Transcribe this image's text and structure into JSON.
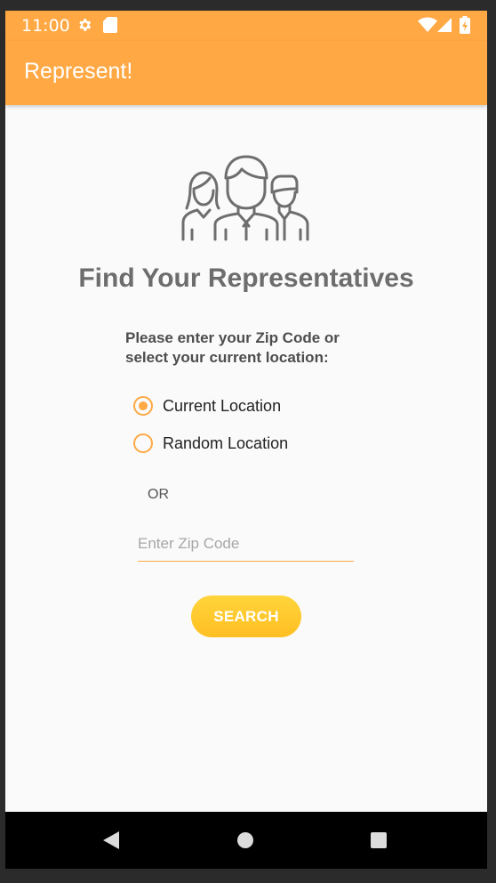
{
  "status_bar": {
    "time": "11:00",
    "icons": [
      "settings-icon",
      "sd-card-icon",
      "wifi-icon",
      "signal-icon",
      "battery-charging-icon"
    ]
  },
  "app_bar": {
    "title": "Represent!"
  },
  "main": {
    "illustration": "people-group-icon",
    "heading": "Find Your Representatives",
    "prompt": "Please enter your Zip Code  or\nselect your current location:",
    "radio_options": [
      {
        "label": "Current Location",
        "checked": true
      },
      {
        "label": "Random Location",
        "checked": false
      }
    ],
    "or_label": "OR",
    "zip_input": {
      "value": "",
      "placeholder": "Enter Zip Code"
    },
    "search_label": "SEARCH"
  },
  "nav_bar": {
    "buttons": [
      "back-icon",
      "home-icon",
      "recents-icon"
    ]
  },
  "colors": {
    "primary": "#ffa844",
    "button": "#ffcb2b",
    "background": "#fafafa",
    "heading": "#6d6d6d"
  }
}
